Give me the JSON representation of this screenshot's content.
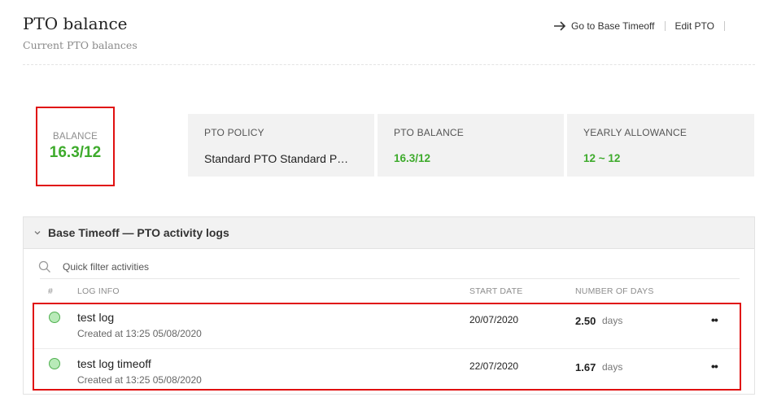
{
  "header": {
    "title": "PTO balance",
    "subtitle": "Current PTO balances",
    "actions": {
      "go_to": "Go to Base Timeoff",
      "edit": "Edit PTO"
    }
  },
  "balance": {
    "label": "BALANCE",
    "value": "16.3/12"
  },
  "cards": [
    {
      "label": "PTO POLICY",
      "value": "Standard PTO Standard P…"
    },
    {
      "label": "PTO BALANCE",
      "value": "16.3/12"
    },
    {
      "label": "YEARLY ALLOWANCE",
      "value": "12 ~ 12"
    }
  ],
  "logs": {
    "title": "Base Timeoff — PTO activity logs",
    "search_placeholder": "Quick filter activities",
    "columns": {
      "index": "#",
      "info": "LOG INFO",
      "start": "START DATE",
      "days": "NUMBER OF DAYS"
    },
    "rows": [
      {
        "title": "test log",
        "meta": "Created at 13:25 05/08/2020",
        "start": "20/07/2020",
        "days": "2.50",
        "unit": "days",
        "menu": "••"
      },
      {
        "title": "test log timeoff",
        "meta": "Created at 13:25 05/08/2020",
        "start": "22/07/2020",
        "days": "1.67",
        "unit": "days",
        "menu": "••"
      }
    ]
  },
  "colors": {
    "accent_green": "#3eab2c",
    "highlight_red": "#e01010",
    "card_bg": "#f2f2f2"
  }
}
